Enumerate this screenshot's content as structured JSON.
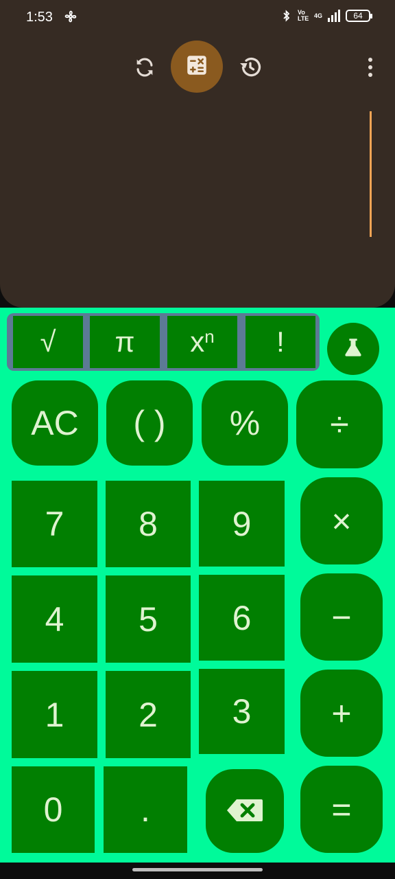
{
  "status_bar": {
    "time": "1:53",
    "volte": "Vo LTE",
    "network": "4G",
    "battery": "64"
  },
  "toolbar": {
    "convert_icon": "sync-icon",
    "calculator_icon": "calculator-icon",
    "history_icon": "history-icon",
    "menu_icon": "more-vert-icon"
  },
  "scientific": {
    "sqrt": "√",
    "pi": "π",
    "power_base": "x",
    "power_exp": "n",
    "factorial": "!",
    "lab_icon": "flask-icon"
  },
  "keys": {
    "clear": "AC",
    "parens": "( )",
    "percent": "%",
    "divide": "÷",
    "seven": "7",
    "eight": "8",
    "nine": "9",
    "multiply": "×",
    "four": "4",
    "five": "5",
    "six": "6",
    "minus": "−",
    "one": "1",
    "two": "2",
    "three": "3",
    "plus": "+",
    "zero": "0",
    "dot": ".",
    "backspace_icon": "backspace-icon",
    "equals": "="
  },
  "colors": {
    "display_bg": "#362b23",
    "keypad_bg": "#00fa9a",
    "key_bg": "#017f01",
    "key_text": "#dff3d0",
    "accent": "#8a5a1f",
    "cursor": "#f0a455"
  }
}
